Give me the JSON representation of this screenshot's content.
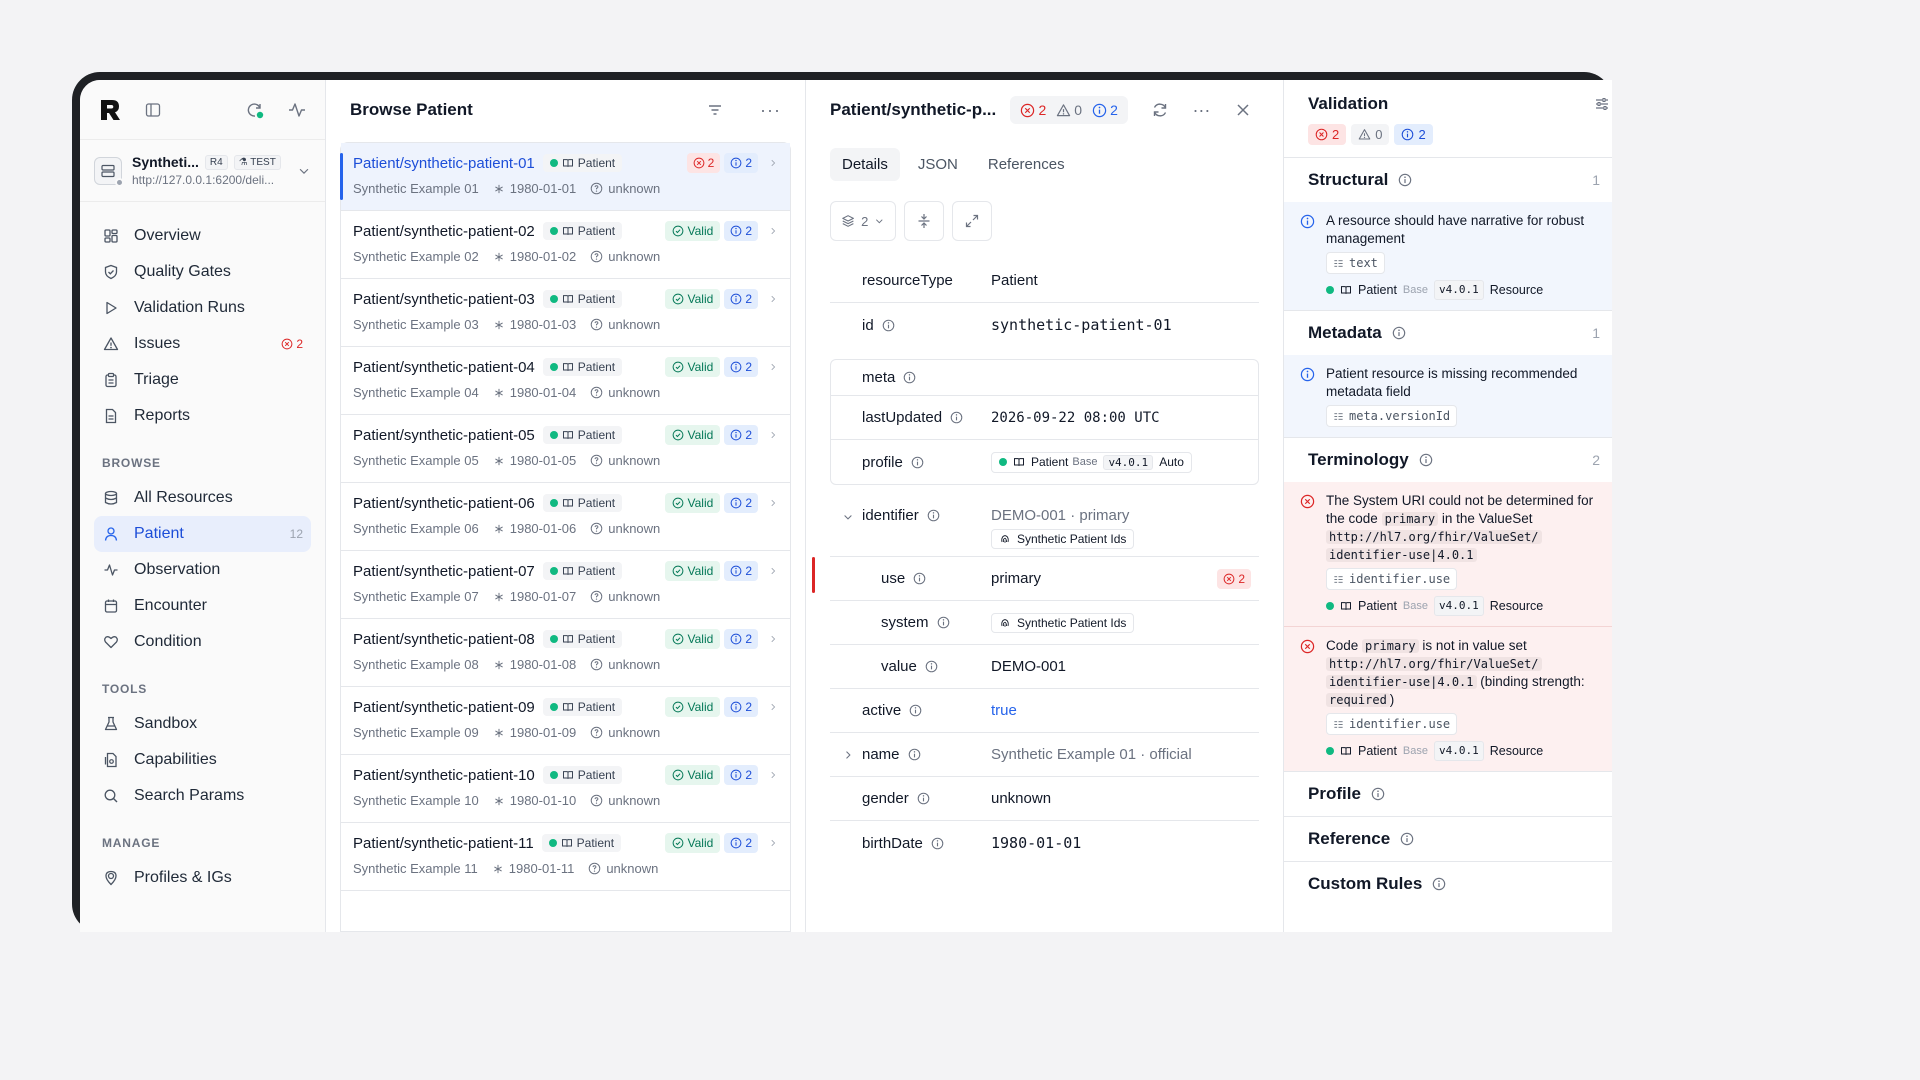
{
  "sidebar": {
    "server": {
      "name": "Syntheti...",
      "version": "R4",
      "env": "TEST",
      "url": "http://127.0.0.1:6200/deli..."
    },
    "nav": [
      {
        "label": "Overview",
        "icon": "grid-icon"
      },
      {
        "label": "Quality Gates",
        "icon": "shield-icon"
      },
      {
        "label": "Validation Runs",
        "icon": "play-icon"
      },
      {
        "label": "Issues",
        "icon": "warning-icon",
        "errors": "2"
      },
      {
        "label": "Triage",
        "icon": "clipboard-icon"
      },
      {
        "label": "Reports",
        "icon": "document-icon"
      }
    ],
    "browse_label": "BROWSE",
    "browse": [
      {
        "label": "All Resources",
        "icon": "database-icon"
      },
      {
        "label": "Patient",
        "icon": "user-icon",
        "count": "12"
      },
      {
        "label": "Observation",
        "icon": "activity-icon"
      },
      {
        "label": "Encounter",
        "icon": "calendar-icon"
      },
      {
        "label": "Condition",
        "icon": "heart-icon"
      }
    ],
    "tools_label": "TOOLS",
    "tools": [
      {
        "label": "Sandbox",
        "icon": "flask-icon"
      },
      {
        "label": "Capabilities",
        "icon": "file-icon"
      },
      {
        "label": "Search Params",
        "icon": "search-icon"
      }
    ],
    "manage_label": "MANAGE",
    "manage": [
      {
        "label": "Profiles & IGs",
        "icon": "map-pin-icon"
      }
    ]
  },
  "list": {
    "title": "Browse Patient",
    "type_tag": "Patient",
    "valid_label": "Valid",
    "gender": "unknown",
    "rows": [
      {
        "id": "Patient/synthetic-patient-01",
        "name": "Synthetic Example 01",
        "dob": "1980-01-01",
        "errors": "2",
        "info": "2",
        "valid": false
      },
      {
        "id": "Patient/synthetic-patient-02",
        "name": "Synthetic Example 02",
        "dob": "1980-01-02",
        "info": "2",
        "valid": true
      },
      {
        "id": "Patient/synthetic-patient-03",
        "name": "Synthetic Example 03",
        "dob": "1980-01-03",
        "info": "2",
        "valid": true
      },
      {
        "id": "Patient/synthetic-patient-04",
        "name": "Synthetic Example 04",
        "dob": "1980-01-04",
        "info": "2",
        "valid": true
      },
      {
        "id": "Patient/synthetic-patient-05",
        "name": "Synthetic Example 05",
        "dob": "1980-01-05",
        "info": "2",
        "valid": true
      },
      {
        "id": "Patient/synthetic-patient-06",
        "name": "Synthetic Example 06",
        "dob": "1980-01-06",
        "info": "2",
        "valid": true
      },
      {
        "id": "Patient/synthetic-patient-07",
        "name": "Synthetic Example 07",
        "dob": "1980-01-07",
        "info": "2",
        "valid": true
      },
      {
        "id": "Patient/synthetic-patient-08",
        "name": "Synthetic Example 08",
        "dob": "1980-01-08",
        "info": "2",
        "valid": true
      },
      {
        "id": "Patient/synthetic-patient-09",
        "name": "Synthetic Example 09",
        "dob": "1980-01-09",
        "info": "2",
        "valid": true
      },
      {
        "id": "Patient/synthetic-patient-10",
        "name": "Synthetic Example 10",
        "dob": "1980-01-10",
        "info": "2",
        "valid": true
      },
      {
        "id": "Patient/synthetic-patient-11",
        "name": "Synthetic Example 11",
        "dob": "1980-01-11",
        "info": "2",
        "valid": true
      }
    ]
  },
  "detail": {
    "title": "Patient/synthetic-p...",
    "errors": "2",
    "warnings": "0",
    "info": "2",
    "tabs": [
      "Details",
      "JSON",
      "References"
    ],
    "layers": "2",
    "fields": {
      "resourceType": {
        "k": "resourceType",
        "v": "Patient"
      },
      "id": {
        "k": "id",
        "v": "synthetic-patient-01"
      },
      "meta": {
        "k": "meta"
      },
      "lastUpdated": {
        "k": "lastUpdated",
        "v": "2026-09-22 08:00 UTC"
      },
      "profile": {
        "k": "profile",
        "name": "Patient",
        "base": "Base",
        "ver": "v4.0.1",
        "mode": "Auto"
      },
      "identifier": {
        "k": "identifier",
        "v": "DEMO-001 · primary",
        "system": "Synthetic Patient Ids"
      },
      "use": {
        "k": "use",
        "v": "primary",
        "errors": "2"
      },
      "system": {
        "k": "system",
        "v": "Synthetic Patient Ids"
      },
      "value": {
        "k": "value",
        "v": "DEMO-001"
      },
      "active": {
        "k": "active",
        "v": "true"
      },
      "name": {
        "k": "name",
        "v": "Synthetic Example 01 · official"
      },
      "gender": {
        "k": "gender",
        "v": "unknown"
      },
      "birthDate": {
        "k": "birthDate",
        "v": "1980-01-01"
      }
    }
  },
  "validation": {
    "title": "Validation",
    "errors": "2",
    "warnings": "0",
    "info": "2",
    "profile_name": "Patient",
    "profile_base": "Base",
    "profile_ver": "v4.0.1",
    "profile_scope": "Resource",
    "sections": {
      "structural": {
        "label": "Structural",
        "count": "1"
      },
      "metadata": {
        "label": "Metadata",
        "count": "1"
      },
      "terminology": {
        "label": "Terminology",
        "count": "2"
      },
      "profile": {
        "label": "Profile"
      },
      "reference": {
        "label": "Reference"
      },
      "custom": {
        "label": "Custom Rules"
      }
    },
    "issues": {
      "narrative": {
        "text": "A resource should have narrative for robust management",
        "path": "text"
      },
      "meta": {
        "text": "Patient resource is missing recommended metadata field",
        "path": "meta.versionId"
      },
      "uri": {
        "t1": "The System URI could not be determined for the code",
        "code": "primary",
        "t2": "in the ValueSet",
        "vs1": "http://hl7.org/fhir/ValueSet/",
        "vs2": "identifier-use|4.0.1",
        "path": "identifier.use"
      },
      "code": {
        "t1": "Code",
        "code": "primary",
        "t2": "is not in value set",
        "vs1": "http://hl7.org/fhir/ValueSet/",
        "vs2": "identifier-use|4.0.1",
        "t3": "(binding strength:",
        "strength": "required",
        "t4": ")",
        "path": "identifier.use"
      }
    }
  }
}
